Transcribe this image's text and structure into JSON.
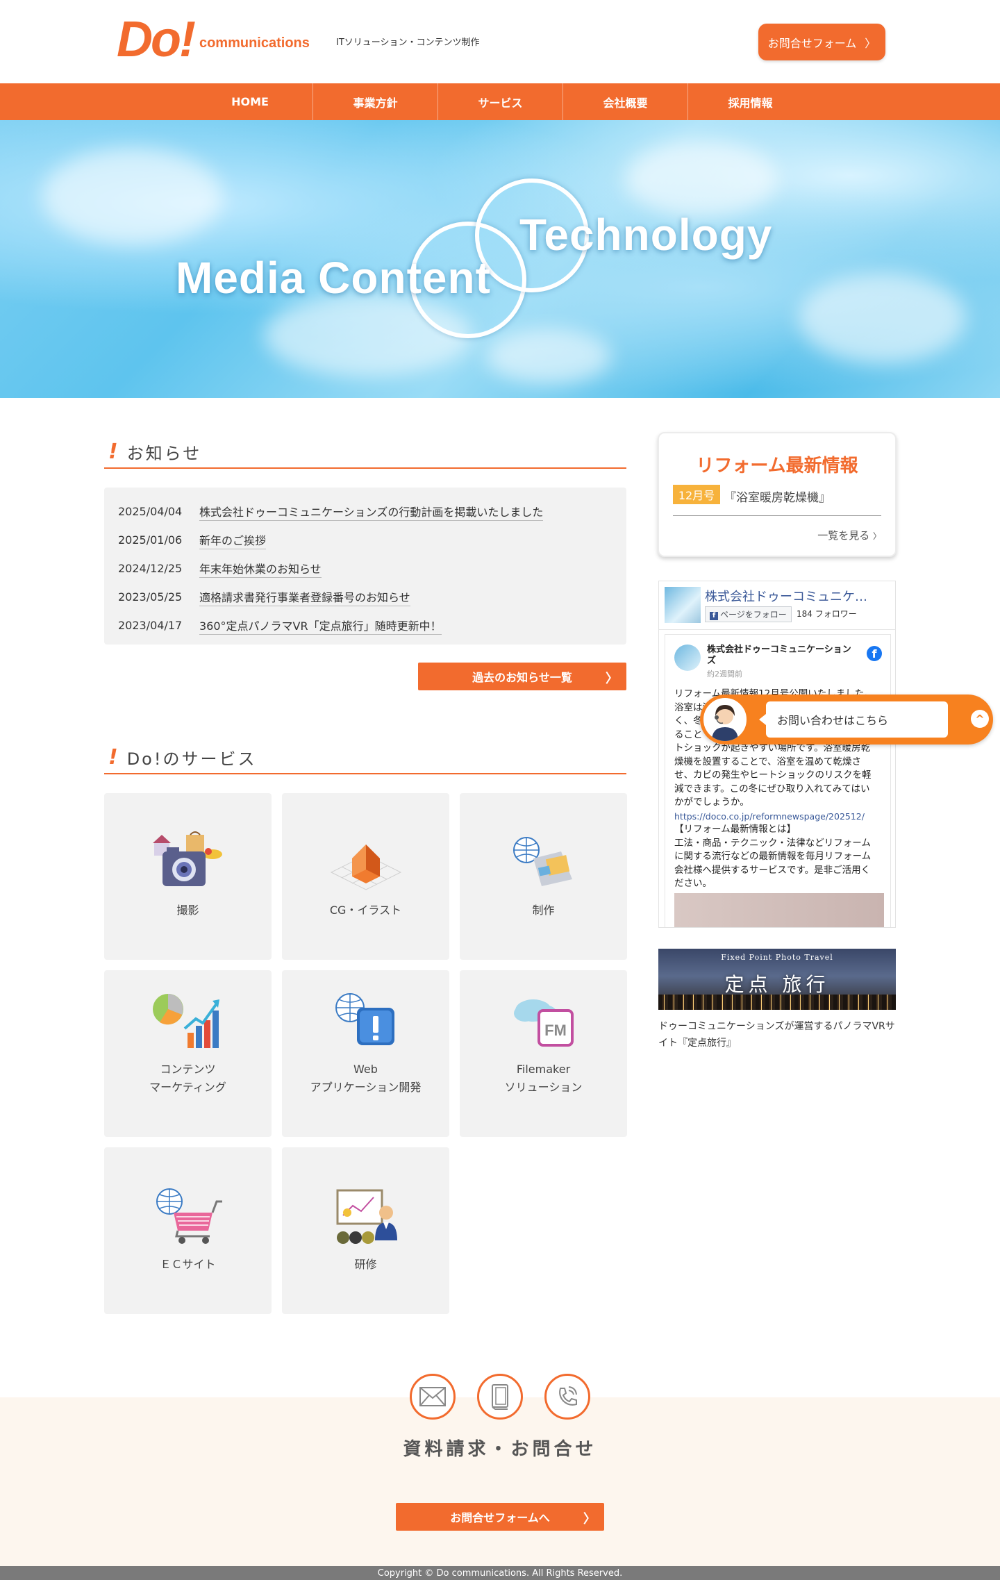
{
  "header": {
    "logo_main": "Do!",
    "logo_sub": "communications",
    "tagline": "ITソリューション・コンテンツ制作",
    "contact_button": "お問合せフォーム",
    "contact_chevron": "〉"
  },
  "nav": {
    "items": [
      {
        "label": "HOME"
      },
      {
        "label": "事業方針"
      },
      {
        "label": "サービス"
      },
      {
        "label": "会社概要"
      },
      {
        "label": "採用情報"
      }
    ]
  },
  "hero": {
    "text_left": "Media Content",
    "text_right": "Technology"
  },
  "news": {
    "title_mark": "!",
    "title": "お知らせ",
    "items": [
      {
        "date": "2025/04/04",
        "text": "株式会社ドゥーコミュニケーションズの行動計画を掲載いたしました"
      },
      {
        "date": "2025/01/06",
        "text": "新年のご挨拶"
      },
      {
        "date": "2024/12/25",
        "text": "年末年始休業のお知らせ"
      },
      {
        "date": "2023/05/25",
        "text": "適格請求書発行事業者登録番号のお知らせ"
      },
      {
        "date": "2023/04/17",
        "text": "360°定点パノラマVR「定点旅行」随時更新中！"
      }
    ],
    "past_button": "過去のお知らせ一覧",
    "past_chevron": "〉"
  },
  "services": {
    "title_mark": "!",
    "title": "Do!のサービス",
    "items": [
      {
        "label": "撮影",
        "icon": "camera-icon"
      },
      {
        "label": "CG・イラスト",
        "icon": "cg-house-icon"
      },
      {
        "label": "制作",
        "icon": "production-icon"
      },
      {
        "label": "コンテンツ\nマーケティング",
        "icon": "marketing-chart-icon"
      },
      {
        "label": "Web\nアプリケーション開発",
        "icon": "web-app-icon"
      },
      {
        "label": "Filemaker\nソリューション",
        "icon": "filemaker-icon"
      },
      {
        "label": "ＥＣサイト",
        "icon": "shopping-cart-icon"
      },
      {
        "label": "研修",
        "icon": "training-icon"
      }
    ]
  },
  "reform": {
    "title": "リフォーム最新情報",
    "month": "12月号",
    "article": "『浴室暖房乾燥機』",
    "more": "一覧を見る",
    "more_chevron": "〉"
  },
  "facebook": {
    "page_name": "株式会社ドゥーコミュニケ…",
    "follow_button": "ページをフォロー",
    "followers": "184 フォロワー",
    "post_author": "株式会社ドゥーコミュニケーションズ",
    "post_time": "約2週間前",
    "post_lines": [
      "リフォーム最新情報12月号公開いたしました。",
      "浴室は湿",
      "く、冬",
      "ること",
      "トショックが起きやすい場所です。浴室暖房乾",
      "燥機を設置することで、浴室を温めて乾燥さ",
      "せ、カビの発生やヒートショックのリスクを軽",
      "減できます。この冬にぜひ取り入れてみてはい",
      "かがでしょうか。"
    ],
    "post_link": "https://doco.co.jp/reformnewspage/202512/",
    "post_lines2": [
      "【リフォーム最新情報とは】",
      "工法・商品・テクニック・法律などリフォーム",
      "に関する流行などの最新情報を毎月リフォーム",
      "会社様へ提供するサービスです。是非ご活用く",
      "ださい。"
    ]
  },
  "chat": {
    "label": "お問い合わせはこちら",
    "up_icon": "^"
  },
  "banner": {
    "subtitle": "Fixed Point Photo Travel",
    "title": "定点 旅行",
    "caption": "ドゥーコミュニケーションズが運営するパノラマVRサイト『定点旅行』"
  },
  "contact": {
    "title": "資料請求・お問合せ",
    "button": "お問合せフォームへ",
    "chevron": "〉"
  },
  "footer": {
    "copyright": "Copyright © Do communications. All Rights Reserved."
  },
  "colors": {
    "brand": "#f26b2e",
    "chat": "#f7811f",
    "month_badge": "#f7b23b"
  }
}
